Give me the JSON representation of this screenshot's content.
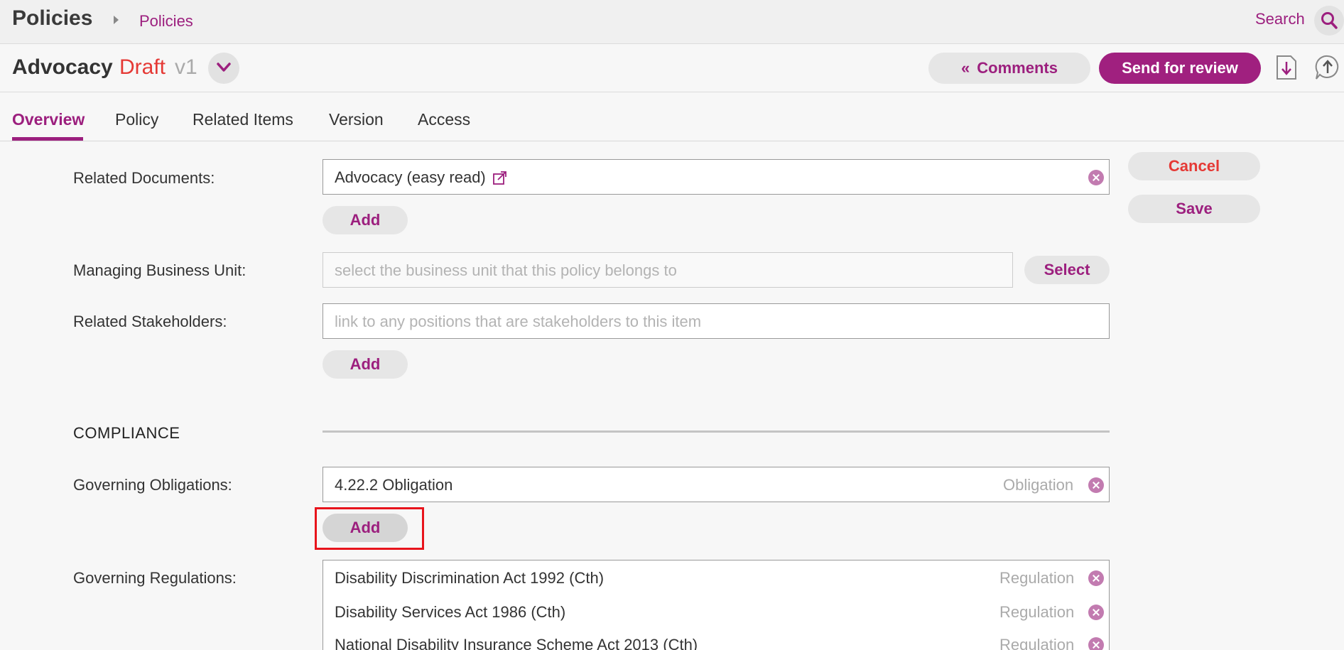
{
  "topbar": {
    "app_title": "Policies",
    "breadcrumb": "Policies",
    "search_label": "Search"
  },
  "document": {
    "title": "Advocacy",
    "status": "Draft",
    "version": "v1"
  },
  "actions": {
    "comments_label": "Comments",
    "comments_chevron": "«",
    "send_for_review_label": "Send for review",
    "cancel_label": "Cancel",
    "save_label": "Save"
  },
  "tabs": [
    {
      "label": "Overview",
      "active": true
    },
    {
      "label": "Policy",
      "active": false
    },
    {
      "label": "Related Items",
      "active": false
    },
    {
      "label": "Version",
      "active": false
    },
    {
      "label": "Access",
      "active": false
    }
  ],
  "form": {
    "related_documents": {
      "label": "Related Documents:",
      "items": [
        {
          "value": "Advocacy (easy read)"
        }
      ],
      "add_label": "Add"
    },
    "managing_business_unit": {
      "label": "Managing Business Unit:",
      "placeholder": "select the business unit that this policy belongs to",
      "select_label": "Select"
    },
    "related_stakeholders": {
      "label": "Related Stakeholders:",
      "placeholder": "link to any positions that are stakeholders to this item",
      "add_label": "Add"
    },
    "compliance_section": {
      "heading": "COMPLIANCE"
    },
    "governing_obligations": {
      "label": "Governing Obligations:",
      "items": [
        {
          "value": "4.22.2 Obligation",
          "type": "Obligation"
        }
      ],
      "add_label": "Add"
    },
    "governing_regulations": {
      "label": "Governing Regulations:",
      "items": [
        {
          "value": "Disability Discrimination Act 1992 (Cth)",
          "type": "Regulation"
        },
        {
          "value": "Disability Services Act 1986 (Cth)",
          "type": "Regulation"
        },
        {
          "value": "National Disability Insurance Scheme Act 2013 (Cth)",
          "type": "Regulation"
        }
      ]
    }
  },
  "colors": {
    "accent": "#9c1f7e",
    "status_red": "#e53935",
    "highlight_red": "#e8141c"
  }
}
